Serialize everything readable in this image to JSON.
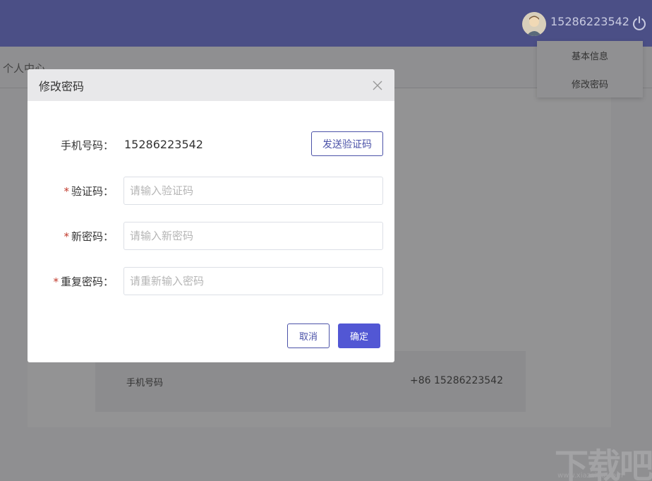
{
  "header": {
    "username": "15286223542",
    "avatar_icon": "user-avatar-icon",
    "power_icon": "power-icon"
  },
  "page": {
    "title": "个人中心",
    "info_label": "手机号码",
    "info_value": "+86 15286223542"
  },
  "dropdown": {
    "items": [
      {
        "label": "基本信息"
      },
      {
        "label": "修改密码"
      }
    ]
  },
  "dialog": {
    "title": "修改密码",
    "close_icon": "close-icon",
    "phone_label": "手机号码：",
    "phone_value": "15286223542",
    "send_code_label": "发送验证码",
    "code_label": "验证码：",
    "code_placeholder": "请输入验证码",
    "new_password_label": "新密码：",
    "new_password_placeholder": "请输入新密码",
    "repeat_password_label": "重复密码：",
    "repeat_password_placeholder": "请重新输入密码",
    "required_mark": "*",
    "cancel_label": "取消",
    "confirm_label": "确定"
  },
  "watermark": {
    "text": "下载吧",
    "url": "www.xiazaiba.com"
  },
  "colors": {
    "topbar": "#4b4f86",
    "accent": "#5257d4",
    "required": "#c0392b"
  }
}
